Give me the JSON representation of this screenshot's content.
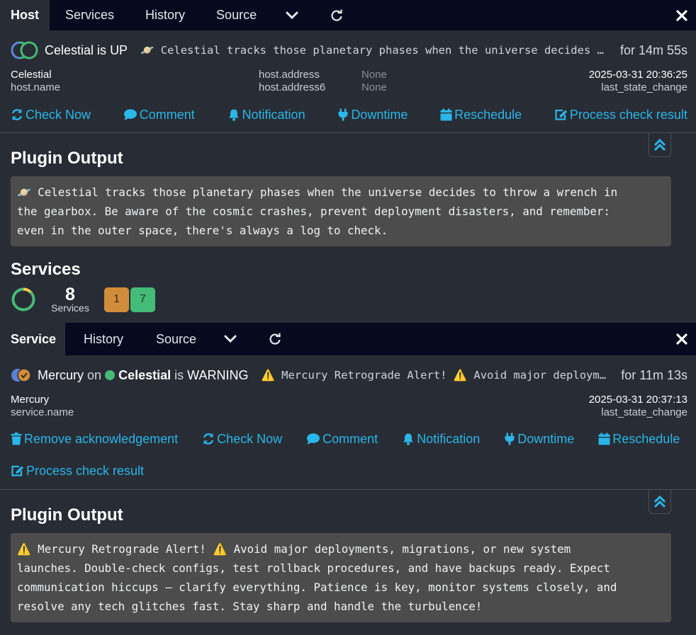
{
  "host_panel": {
    "tabs": [
      "Host",
      "Services",
      "History",
      "Source"
    ],
    "title": {
      "name": "Celestial",
      "is": "is",
      "state": "UP"
    },
    "summary": "🪐 Celestial tracks those planetary phases when the universe decides to throw a wrench in the gearbox. Be aware of the cosmic crashes, prevent deployment disasters, and remember: even in the outer space, there's always a log to check.",
    "since": "for 14m 55s",
    "meta": {
      "name_value": "Celestial",
      "name_key": "host.name",
      "address_key": "host.address",
      "address_value": "None",
      "address6_key": "host.address6",
      "address6_value": "None",
      "timestamp": "2025-03-31 20:36:25",
      "timestamp_key": "last_state_change"
    },
    "actions": [
      "Check Now",
      "Comment",
      "Notification",
      "Downtime",
      "Reschedule",
      "Process check result"
    ],
    "plugin_output_title": "Plugin Output",
    "plugin_output": "🪐 Celestial tracks those planetary phases when the universe decides to throw a wrench in\nthe gearbox. Be aware of the cosmic crashes, prevent deployment disasters, and remember:\neven in the outer space, there's always a log to check.",
    "services": {
      "title": "Services",
      "total": "8",
      "total_label": "Services",
      "warning": "1",
      "ok": "7"
    }
  },
  "service_panel": {
    "tabs": [
      "Service",
      "History",
      "Source"
    ],
    "title": {
      "service": "Mercury",
      "on": "on",
      "host": "Celestial",
      "is": "is",
      "state": "WARNING"
    },
    "summary": "⚠️ Mercury Retrograde Alert! ⚠️ Avoid major deployments, migrations, or new system launches.",
    "since": "for 11m 13s",
    "meta": {
      "name_value": "Mercury",
      "name_key": "service.name",
      "timestamp": "2025-03-31 20:37:13",
      "timestamp_key": "last_state_change"
    },
    "actions": [
      "Remove acknowledgement",
      "Check Now",
      "Comment",
      "Notification",
      "Downtime",
      "Reschedule",
      "Process check result"
    ],
    "plugin_output_title": "Plugin Output",
    "plugin_output": "⚠️ Mercury Retrograde Alert! ⚠️ Avoid major deployments, migrations, or new system\nlaunches. Double-check configs, test rollback procedures, and have backups ready. Expect\ncommunication hiccups – clarify everything. Patience is key, monitor systems closely, and\nresolve any tech glitches fast. Stay sharp and handle the turbulence!"
  },
  "colors": {
    "accent": "#29b6e8",
    "ok": "#44bb77",
    "warning": "#d18d3c",
    "tabbar": "#060a1f",
    "background": "#282c34"
  },
  "icons": [
    "chevron-down-icon",
    "refresh-icon",
    "close-icon",
    "sync-icon",
    "comment-icon",
    "bell-icon",
    "plug-icon",
    "calendar-icon",
    "edit-icon",
    "trash-icon",
    "double-chevron-up-icon",
    "warning-icon"
  ]
}
